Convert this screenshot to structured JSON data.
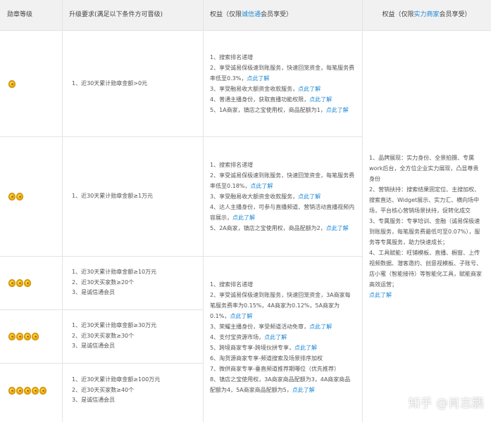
{
  "headers": {
    "level": "勋章等级",
    "requirement": "升级要求(满足以下条件方可晋级)",
    "rights1_prefix": "权益（仅限",
    "rights1_highlight": "诚信通",
    "rights1_suffix": "会员享受）",
    "rights2_prefix": "权益（仅限",
    "rights2_highlight": "实力商家",
    "rights2_suffix": "会员享受）"
  },
  "rows": [
    {
      "medals": 1,
      "requirements": [
        "1、近30天累计勋章金额>0元"
      ],
      "rights": [
        {
          "text": "1、搜索排名递增",
          "link": ""
        },
        {
          "text": "2、享受诚易保极速到账服务，快速回笼资金，每笔服务费率低至0.3%，",
          "link": "点此了解"
        },
        {
          "text": "3、享受融易收大额资金收款服务，",
          "link": "点此了解"
        },
        {
          "text": "4、普通主播身份，获取直播功能权限，",
          "link": "点此了解"
        },
        {
          "text": "5、1A商家，镇店之宝使用权，商品配额为1，",
          "link": "点此了解"
        }
      ]
    },
    {
      "medals": 2,
      "requirements": [
        "1、近30天累计勋章金额≥1万元"
      ],
      "rights": [
        {
          "text": "1、搜索排名递增",
          "link": ""
        },
        {
          "text": "2、享受诚易保极速到账服务，快速回笼资金，每笔服务费率低至0.18%，",
          "link": "点此了解"
        },
        {
          "text": "3、享受融易收大额资金收款服务，",
          "link": "点此了解"
        },
        {
          "text": "4、达人主播身份，可参与直播频道、营销活动直播视频内容展示，",
          "link": "点此了解"
        },
        {
          "text": "5、2A商家，镇店之宝使用权，商品配额为2，",
          "link": "点此了解"
        }
      ]
    },
    {
      "medals": 3,
      "requirements": [
        "1、近30天累计勋章金额≥10万元",
        "2、近30天买家数≥20个",
        "3、是诚信通会员"
      ]
    },
    {
      "medals": 4,
      "requirements": [
        "1、近30天累计勋章金额≥30万元",
        "2、近30天买家数≥30个",
        "3、是诚信通会员"
      ]
    },
    {
      "medals": 5,
      "requirements": [
        "1、近30天累计勋章金额≥100万元",
        "2、近30天买家数≥40个",
        "3、是诚信通会员"
      ]
    }
  ],
  "shared_rights": [
    {
      "text": "1、搜索排名递增",
      "link": ""
    },
    {
      "text": "2、享受诚易保极速到账服务，快速回笼资金，3A商家每笔服务费率为0.15%，4A商家为0.12%，5A商家为0.1%，",
      "link": "点此了解"
    },
    {
      "text": "3、荣耀主播身份，享受频道活动免审，",
      "link": "点此了解"
    },
    {
      "text": "4、支付宝资源市场，",
      "link": "点此了解"
    },
    {
      "text": "5、跨境商家专享-跨境伙拼专享，",
      "link": "点此了解"
    },
    {
      "text": "6、淘货源商家专享-频道搜索及场景排序加权",
      "link": ""
    },
    {
      "text": "7、微供商家专享-垂直频道推荐期曝位（优先推荐）",
      "link": ""
    },
    {
      "text": "8、镇店之宝使用权，3A商家商品配额为3，4A商家商品配额为4，5A商家商品配额为5，",
      "link": "点此了解"
    }
  ],
  "strength_rights": [
    {
      "text": "1、品牌展现：实力身份、全景拍摄、专属work后台，全方位企业实力展现，凸显尊贵身份",
      "link": ""
    },
    {
      "text": "2、营销扶持：搜索结果固定位、主搜加权、搜索直达、Widget展示、实力汇、横向场中场，平台核心营销场景扶持，促转化成交",
      "link": ""
    },
    {
      "text": "3、专属服务：专享培训、金融（诚易保极速到账服务，每笔服务费最低可至0.07%），服务等专属服务，助力快速成长；",
      "link": ""
    },
    {
      "text": "4、工具赋能：旺铺模板、直播、橱窗、上传视频数据、潜客邀约、创意视模板、子账号、店小蜜（智能接待）等智能化工具，赋能商家高效运营；",
      "link": ""
    },
    {
      "text": "",
      "link": "点此了解"
    }
  ],
  "watermark": "知乎 @肖志鹏"
}
